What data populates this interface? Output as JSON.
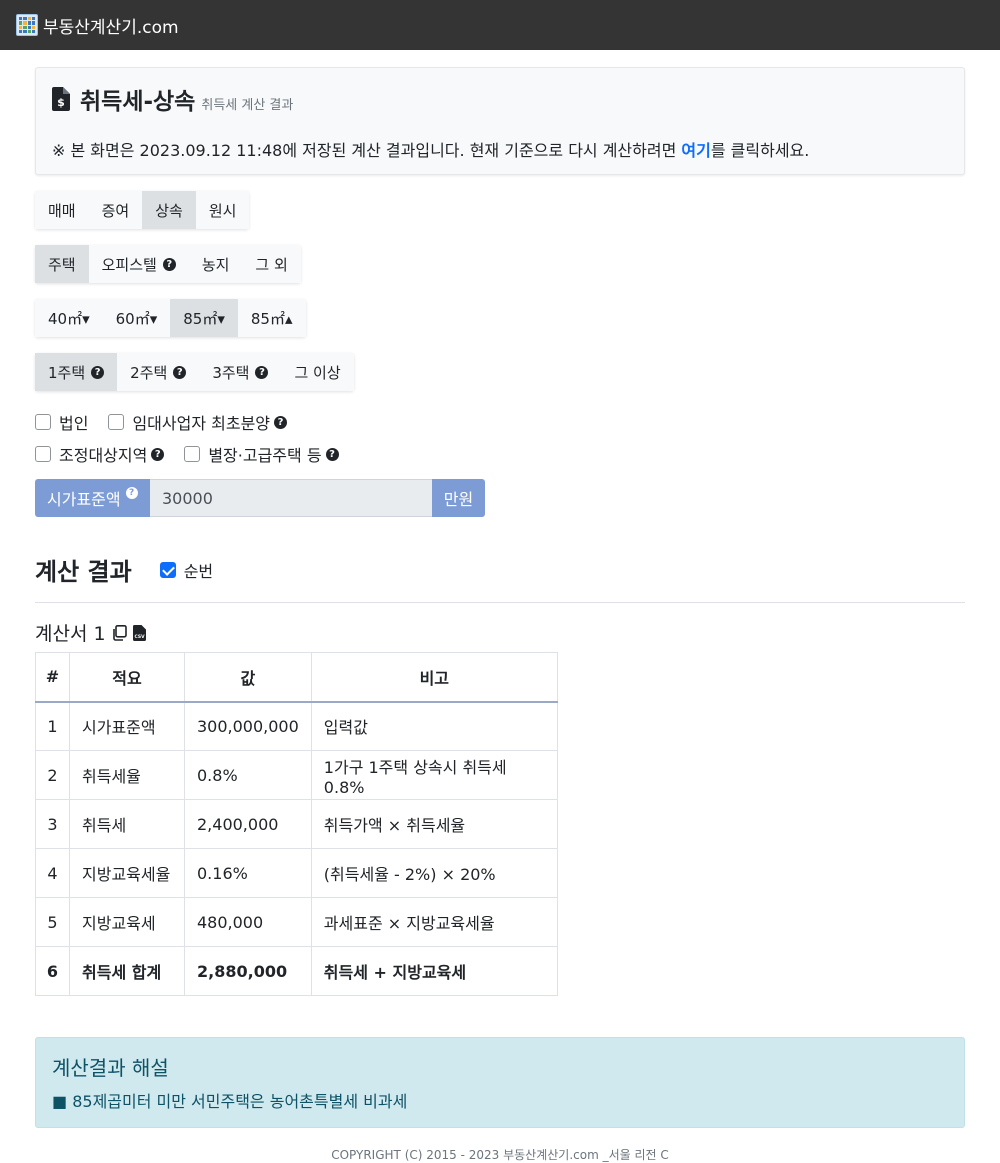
{
  "brand": {
    "name": "부동산계산기.com"
  },
  "header": {
    "title": "취득세-상속",
    "subtitle": "취득세 계산 결과",
    "note_prefix": "※ 본 화면은 2023.09.12 11:48에 저장된 계산 결과입니다. 현재 기준으로 다시 계산하려면 ",
    "note_link": "여기",
    "note_suffix": "를 클릭하세요."
  },
  "tabs_type": [
    {
      "label": "매매",
      "active": false
    },
    {
      "label": "증여",
      "active": false
    },
    {
      "label": "상속",
      "active": true
    },
    {
      "label": "원시",
      "active": false
    }
  ],
  "tabs_property": [
    {
      "label": "주택",
      "active": true,
      "help": false
    },
    {
      "label": "오피스텔",
      "active": false,
      "help": true
    },
    {
      "label": "농지",
      "active": false,
      "help": false
    },
    {
      "label": "그 외",
      "active": false,
      "help": false
    }
  ],
  "tabs_area": [
    {
      "label": "40㎡▾",
      "active": false
    },
    {
      "label": "60㎡▾",
      "active": false
    },
    {
      "label": "85㎡▾",
      "active": true
    },
    {
      "label": "85㎡▴",
      "active": false
    }
  ],
  "tabs_count": [
    {
      "label": "1주택",
      "active": true,
      "help": true
    },
    {
      "label": "2주택",
      "active": false,
      "help": true
    },
    {
      "label": "3주택",
      "active": false,
      "help": true
    },
    {
      "label": "그 이상",
      "active": false,
      "help": false
    }
  ],
  "checks_row1": [
    {
      "label": "법인",
      "checked": false,
      "help": false
    },
    {
      "label": "임대사업자 최초분양",
      "checked": false,
      "help": true
    }
  ],
  "checks_row2": [
    {
      "label": "조정대상지역",
      "checked": false,
      "help": true
    },
    {
      "label": "별장·고급주택 등",
      "checked": false,
      "help": true
    }
  ],
  "price": {
    "label": "시가표준액",
    "value": "30000",
    "unit": "만원"
  },
  "result": {
    "title": "계산 결과",
    "numbering_label": "순번",
    "numbering_checked": true,
    "sheet_title": "계산서 1",
    "columns": [
      "#",
      "적요",
      "값",
      "비고"
    ],
    "rows": [
      [
        "1",
        "시가표준액",
        "300,000,000",
        "입력값"
      ],
      [
        "2",
        "취득세율",
        "0.8%",
        "1가구 1주택 상속시 취득세 0.8%"
      ],
      [
        "3",
        "취득세",
        "2,400,000",
        "취득가액 × 취득세율"
      ],
      [
        "4",
        "지방교육세율",
        "0.16%",
        "(취득세율 - 2%) × 20%"
      ],
      [
        "5",
        "지방교육세",
        "480,000",
        "과세표준 × 지방교육세율"
      ],
      [
        "6",
        "취득세 합계",
        "2,880,000",
        "취득세 + 지방교육세"
      ]
    ]
  },
  "explain": {
    "title": "계산결과 해설",
    "bullet": "■ 85제곱미터 미만 서민주택은 농어촌특별세 비과세"
  },
  "footer": {
    "text": "COPYRIGHT (C) 2015 - 2023 부동산계산기.com _서울 리전 C"
  },
  "colors": {
    "navbar": "#343434",
    "accent": "#7d9cd6",
    "link": "#0d6efd",
    "info_bg": "#cfe9ef"
  }
}
